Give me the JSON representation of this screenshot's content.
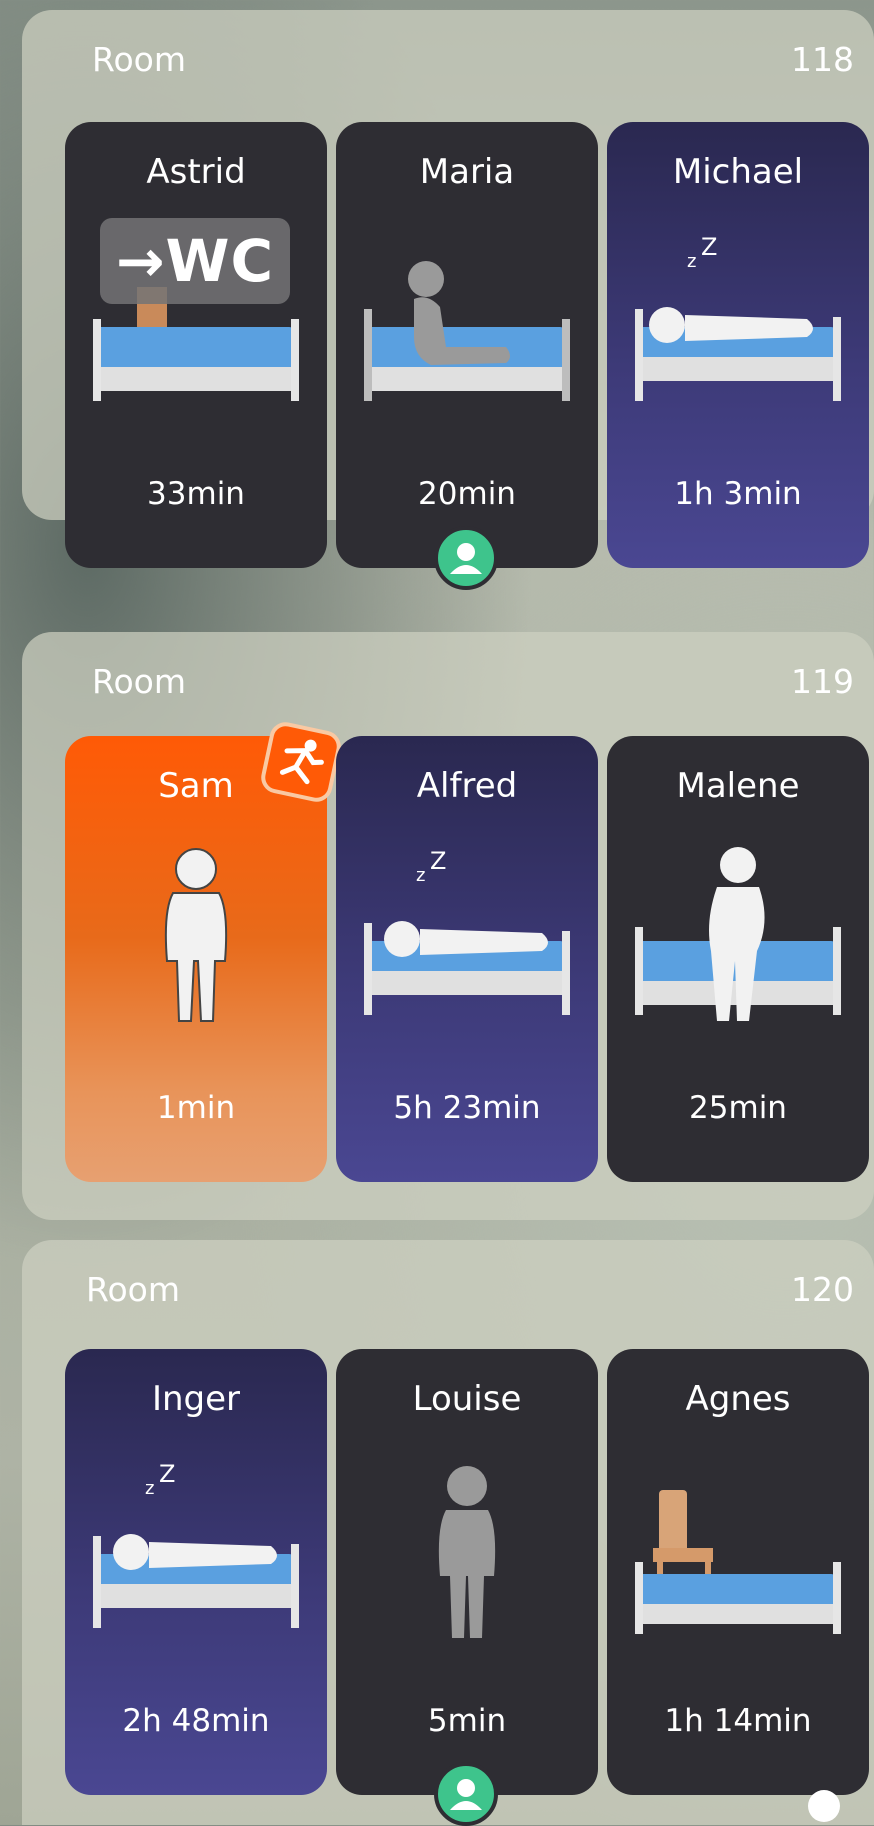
{
  "rooms": [
    {
      "label": "Room",
      "number": "118",
      "residents": [
        {
          "name": "Astrid",
          "time": "33min",
          "state": "toilet",
          "wc_label": "→WC"
        },
        {
          "name": "Maria",
          "time": "20min",
          "state": "sitting-up"
        },
        {
          "name": "Michael",
          "time": "1h 3min",
          "state": "sleeping"
        }
      ]
    },
    {
      "label": "Room",
      "number": "119",
      "residents": [
        {
          "name": "Sam",
          "time": "1min",
          "state": "fall-alert"
        },
        {
          "name": "Alfred",
          "time": "5h 23min",
          "state": "sleeping"
        },
        {
          "name": "Malene",
          "time": "25min",
          "state": "sitting-edge"
        }
      ]
    },
    {
      "label": "Room",
      "number": "120",
      "residents": [
        {
          "name": "Inger",
          "time": "2h 48min",
          "state": "sleeping"
        },
        {
          "name": "Louise",
          "time": "5min",
          "state": "standing"
        },
        {
          "name": "Agnes",
          "time": "1h 14min",
          "state": "out-of-bed"
        }
      ]
    }
  ],
  "icons": {
    "staff_present": "person-badge-icon",
    "fall_alert": "fall-icon",
    "sleep": "zz-icon"
  },
  "colors": {
    "card_dark": "#2e2d33",
    "card_night": "#3d3a78",
    "alert": "#ff5a06",
    "staff_badge": "#3ec48c"
  }
}
